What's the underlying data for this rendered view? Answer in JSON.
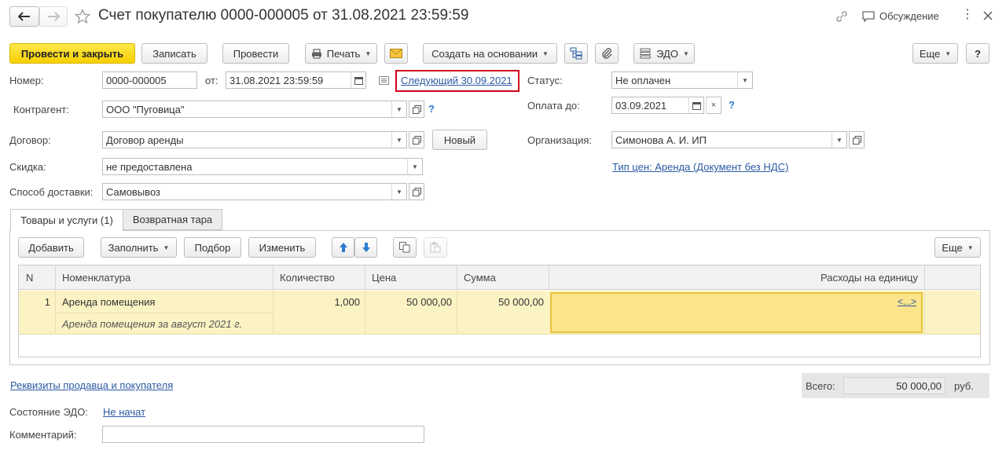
{
  "window": {
    "title": "Счет покупателю 0000-000005 от 31.08.2021 23:59:59",
    "discussion_label": "Обсуждение"
  },
  "toolbar": {
    "post_close": "Провести и закрыть",
    "save": "Записать",
    "post": "Провести",
    "print": "Печать",
    "create_based": "Создать на основании",
    "edo": "ЭДО",
    "more": "Еще",
    "help": "?"
  },
  "form": {
    "number_label": "Номер:",
    "number_value": "0000-000005",
    "from_label": "от:",
    "date_value": "31.08.2021 23:59:59",
    "next_link": "Следующий 30.09.2021",
    "status_label": "Статус:",
    "status_value": "Не оплачен",
    "counterparty_label": "Контрагент:",
    "counterparty_value": "ООО \"Пуговица\"",
    "pay_until_label": "Оплата до:",
    "pay_until_value": "03.09.2021",
    "contract_label": "Договор:",
    "contract_value": "Договор аренды",
    "new_button": "Новый",
    "organization_label": "Организация:",
    "organization_value": "Симонова А. И. ИП",
    "discount_label": "Скидка:",
    "discount_value": "не предоставлена",
    "price_type_link": "Тип цен: Аренда (Документ без НДС)",
    "delivery_label": "Способ доставки:",
    "delivery_value": "Самовывоз",
    "question": "?"
  },
  "tabs": [
    {
      "label": "Товары и услуги (1)"
    },
    {
      "label": "Возвратная тара"
    }
  ],
  "table_toolbar": {
    "add": "Добавить",
    "fill": "Заполнить",
    "selection": "Подбор",
    "change": "Изменить",
    "more": "Еще"
  },
  "table": {
    "columns": [
      "N",
      "Номенклатура",
      "Количество",
      "Цена",
      "Сумма",
      "Расходы на единицу"
    ],
    "rows": [
      {
        "n": "1",
        "item": "Аренда помещения",
        "item_comment": "Аренда помещения за август 2021 г.",
        "qty": "1,000",
        "price": "50 000,00",
        "sum": "50 000,00",
        "expense_link": "<...>"
      }
    ]
  },
  "footer": {
    "requisites_link": "Реквизиты продавца и покупателя",
    "total_label": "Всего:",
    "total_value": "50 000,00",
    "currency": "руб.",
    "edo_state_label": "Состояние ЭДО:",
    "edo_state_value": "Не начат",
    "comment_label": "Комментарий:",
    "comment_value": ""
  },
  "colors": {
    "primary_button": "#f7d000",
    "link": "#2b5aa3",
    "highlight_border": "#d0021b",
    "selected_row": "#fbf3c4",
    "active_cell": "#fbe48a"
  }
}
